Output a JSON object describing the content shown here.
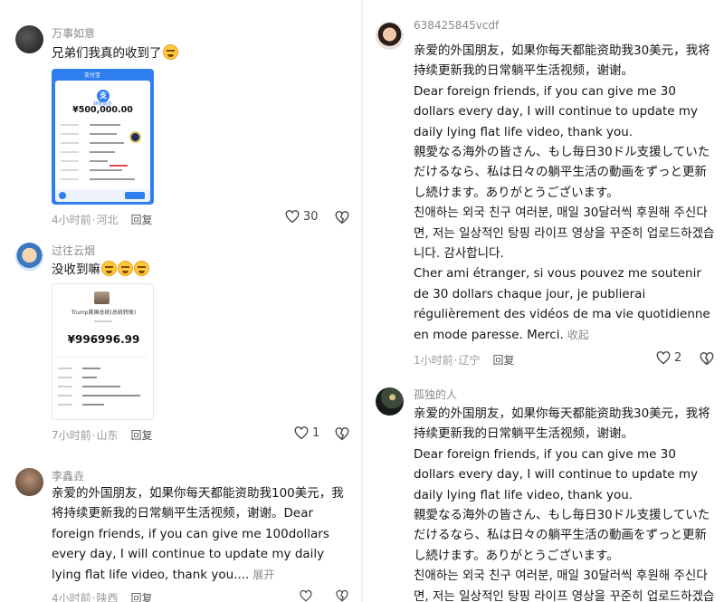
{
  "left": {
    "c1": {
      "username": "万事如意",
      "text": "兄弟们我真的收到了",
      "receipt": {
        "header": "支付宝",
        "label": "转账成功",
        "amount": "¥500,000.00"
      },
      "time": "4小时前",
      "location": "河北",
      "reply": "回复",
      "likes": "30"
    },
    "c2": {
      "username": "过往云烟",
      "text": "没收到嘛",
      "receipt": {
        "title": "Trump美国总统(总统转账)",
        "amount": "¥996996.99"
      },
      "time": "7小时前",
      "location": "山东",
      "reply": "回复",
      "likes": "1"
    },
    "c3": {
      "username": "李鑫垚",
      "text": "亲爱的外国朋友，如果你每天都能资助我100美元，我将持续更新我的日常躺平生活视频，谢谢。Dear foreign friends, if you can give me 100dollars every day, I will continue to update my daily lying flat life video, thank you....",
      "more": "展开",
      "time": "4小时前",
      "location": "陕西",
      "reply": "回复"
    }
  },
  "right": {
    "c1": {
      "username": "638425845vcdf",
      "zh": "亲爱的外国朋友，如果你每天都能资助我30美元，我将持续更新我的日常躺平生活视频，谢谢。",
      "en": "Dear foreign friends, if you can give me 30 dollars every day, I will continue to update my daily lying flat life video, thank you.",
      "ja": "親愛なる海外の皆さん、もし毎日30ドル支援していただけるなら、私は日々の躺平生活の動画をずっと更新し続けます。ありがとうございます。",
      "ko": "친애하는 외국 친구 여러분, 매일 30달러씩 후원해 주신다면, 저는 일상적인 탕핑 라이프 영상을 꾸준히 업로드하겠습니다. 감사합니다.",
      "fr": "Cher ami étranger, si vous pouvez me soutenir de 30 dollars chaque jour, je publierai régulièrement des vidéos de ma vie quotidienne en mode paresse. Merci.",
      "collapse": "收起",
      "time": "1小时前",
      "location": "辽宁",
      "reply": "回复",
      "likes": "2"
    },
    "c2": {
      "username": "孤独的人",
      "zh": "亲爱的外国朋友，如果你每天都能资助我30美元，我将持续更新我的日常躺平生活视频，谢谢。",
      "en": "Dear foreign friends, if you can give me 30 dollars every day, I will continue to update my daily lying flat life video, thank you.",
      "ja": "親愛なる海外の皆さん、もし毎日30ドル支援していただけるなら、私は日々の躺平生活の動画をずっと更新し続けます。ありがとうございます。",
      "ko": "친애하는 외국 친구 여러분, 매일 30달러씩 후원해 주신다면, 저는 일상적인 탕핑 라이프 영상을 꾸준히 업로드하겠습니다."
    }
  },
  "separator": "·",
  "icons": {
    "like": "heart-outline-icon",
    "dislike": "broken-heart-icon",
    "emoji_grin": "grinning-face-icon",
    "emoji_worried": "worried-face-icon"
  }
}
